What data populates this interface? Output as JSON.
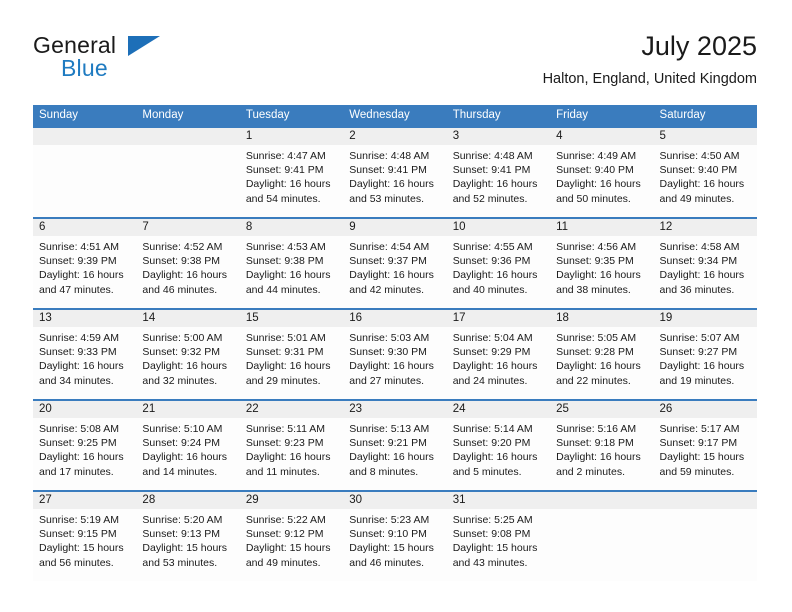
{
  "brand": {
    "name_primary": "General",
    "name_secondary": "Blue",
    "triangle_color": "#1d6fb8",
    "blue_color": "#1f7bc1"
  },
  "header": {
    "title": "July 2025",
    "location": "Halton, England, United Kingdom"
  },
  "theme": {
    "header_bg": "#3a7cbe",
    "header_text": "#ffffff",
    "daynum_band_bg": "#efefef",
    "cell_bg": "#fdfdfd",
    "row_divider": "#3a7cbe",
    "text": "#1a1a1a"
  },
  "calendar": {
    "weekdays": [
      "Sunday",
      "Monday",
      "Tuesday",
      "Wednesday",
      "Thursday",
      "Friday",
      "Saturday"
    ],
    "weeks": [
      [
        {
          "day": "",
          "sunrise": "",
          "sunset": "",
          "daylight": ""
        },
        {
          "day": "",
          "sunrise": "",
          "sunset": "",
          "daylight": ""
        },
        {
          "day": "1",
          "sunrise": "Sunrise: 4:47 AM",
          "sunset": "Sunset: 9:41 PM",
          "daylight": "Daylight: 16 hours and 54 minutes."
        },
        {
          "day": "2",
          "sunrise": "Sunrise: 4:48 AM",
          "sunset": "Sunset: 9:41 PM",
          "daylight": "Daylight: 16 hours and 53 minutes."
        },
        {
          "day": "3",
          "sunrise": "Sunrise: 4:48 AM",
          "sunset": "Sunset: 9:41 PM",
          "daylight": "Daylight: 16 hours and 52 minutes."
        },
        {
          "day": "4",
          "sunrise": "Sunrise: 4:49 AM",
          "sunset": "Sunset: 9:40 PM",
          "daylight": "Daylight: 16 hours and 50 minutes."
        },
        {
          "day": "5",
          "sunrise": "Sunrise: 4:50 AM",
          "sunset": "Sunset: 9:40 PM",
          "daylight": "Daylight: 16 hours and 49 minutes."
        }
      ],
      [
        {
          "day": "6",
          "sunrise": "Sunrise: 4:51 AM",
          "sunset": "Sunset: 9:39 PM",
          "daylight": "Daylight: 16 hours and 47 minutes."
        },
        {
          "day": "7",
          "sunrise": "Sunrise: 4:52 AM",
          "sunset": "Sunset: 9:38 PM",
          "daylight": "Daylight: 16 hours and 46 minutes."
        },
        {
          "day": "8",
          "sunrise": "Sunrise: 4:53 AM",
          "sunset": "Sunset: 9:38 PM",
          "daylight": "Daylight: 16 hours and 44 minutes."
        },
        {
          "day": "9",
          "sunrise": "Sunrise: 4:54 AM",
          "sunset": "Sunset: 9:37 PM",
          "daylight": "Daylight: 16 hours and 42 minutes."
        },
        {
          "day": "10",
          "sunrise": "Sunrise: 4:55 AM",
          "sunset": "Sunset: 9:36 PM",
          "daylight": "Daylight: 16 hours and 40 minutes."
        },
        {
          "day": "11",
          "sunrise": "Sunrise: 4:56 AM",
          "sunset": "Sunset: 9:35 PM",
          "daylight": "Daylight: 16 hours and 38 minutes."
        },
        {
          "day": "12",
          "sunrise": "Sunrise: 4:58 AM",
          "sunset": "Sunset: 9:34 PM",
          "daylight": "Daylight: 16 hours and 36 minutes."
        }
      ],
      [
        {
          "day": "13",
          "sunrise": "Sunrise: 4:59 AM",
          "sunset": "Sunset: 9:33 PM",
          "daylight": "Daylight: 16 hours and 34 minutes."
        },
        {
          "day": "14",
          "sunrise": "Sunrise: 5:00 AM",
          "sunset": "Sunset: 9:32 PM",
          "daylight": "Daylight: 16 hours and 32 minutes."
        },
        {
          "day": "15",
          "sunrise": "Sunrise: 5:01 AM",
          "sunset": "Sunset: 9:31 PM",
          "daylight": "Daylight: 16 hours and 29 minutes."
        },
        {
          "day": "16",
          "sunrise": "Sunrise: 5:03 AM",
          "sunset": "Sunset: 9:30 PM",
          "daylight": "Daylight: 16 hours and 27 minutes."
        },
        {
          "day": "17",
          "sunrise": "Sunrise: 5:04 AM",
          "sunset": "Sunset: 9:29 PM",
          "daylight": "Daylight: 16 hours and 24 minutes."
        },
        {
          "day": "18",
          "sunrise": "Sunrise: 5:05 AM",
          "sunset": "Sunset: 9:28 PM",
          "daylight": "Daylight: 16 hours and 22 minutes."
        },
        {
          "day": "19",
          "sunrise": "Sunrise: 5:07 AM",
          "sunset": "Sunset: 9:27 PM",
          "daylight": "Daylight: 16 hours and 19 minutes."
        }
      ],
      [
        {
          "day": "20",
          "sunrise": "Sunrise: 5:08 AM",
          "sunset": "Sunset: 9:25 PM",
          "daylight": "Daylight: 16 hours and 17 minutes."
        },
        {
          "day": "21",
          "sunrise": "Sunrise: 5:10 AM",
          "sunset": "Sunset: 9:24 PM",
          "daylight": "Daylight: 16 hours and 14 minutes."
        },
        {
          "day": "22",
          "sunrise": "Sunrise: 5:11 AM",
          "sunset": "Sunset: 9:23 PM",
          "daylight": "Daylight: 16 hours and 11 minutes."
        },
        {
          "day": "23",
          "sunrise": "Sunrise: 5:13 AM",
          "sunset": "Sunset: 9:21 PM",
          "daylight": "Daylight: 16 hours and 8 minutes."
        },
        {
          "day": "24",
          "sunrise": "Sunrise: 5:14 AM",
          "sunset": "Sunset: 9:20 PM",
          "daylight": "Daylight: 16 hours and 5 minutes."
        },
        {
          "day": "25",
          "sunrise": "Sunrise: 5:16 AM",
          "sunset": "Sunset: 9:18 PM",
          "daylight": "Daylight: 16 hours and 2 minutes."
        },
        {
          "day": "26",
          "sunrise": "Sunrise: 5:17 AM",
          "sunset": "Sunset: 9:17 PM",
          "daylight": "Daylight: 15 hours and 59 minutes."
        }
      ],
      [
        {
          "day": "27",
          "sunrise": "Sunrise: 5:19 AM",
          "sunset": "Sunset: 9:15 PM",
          "daylight": "Daylight: 15 hours and 56 minutes."
        },
        {
          "day": "28",
          "sunrise": "Sunrise: 5:20 AM",
          "sunset": "Sunset: 9:13 PM",
          "daylight": "Daylight: 15 hours and 53 minutes."
        },
        {
          "day": "29",
          "sunrise": "Sunrise: 5:22 AM",
          "sunset": "Sunset: 9:12 PM",
          "daylight": "Daylight: 15 hours and 49 minutes."
        },
        {
          "day": "30",
          "sunrise": "Sunrise: 5:23 AM",
          "sunset": "Sunset: 9:10 PM",
          "daylight": "Daylight: 15 hours and 46 minutes."
        },
        {
          "day": "31",
          "sunrise": "Sunrise: 5:25 AM",
          "sunset": "Sunset: 9:08 PM",
          "daylight": "Daylight: 15 hours and 43 minutes."
        },
        {
          "day": "",
          "sunrise": "",
          "sunset": "",
          "daylight": ""
        },
        {
          "day": "",
          "sunrise": "",
          "sunset": "",
          "daylight": ""
        }
      ]
    ]
  }
}
